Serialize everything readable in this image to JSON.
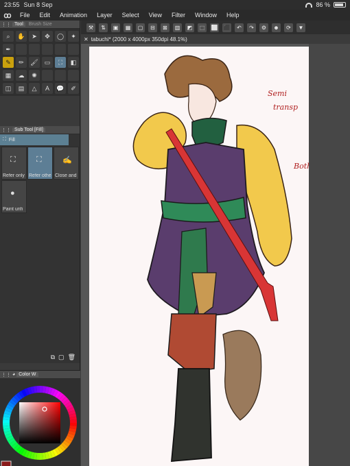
{
  "status": {
    "time": "23:55",
    "date": "Sun 8 Sep",
    "battery": "86 %"
  },
  "menu": [
    "File",
    "Edit",
    "Animation",
    "Layer",
    "Select",
    "View",
    "Filter",
    "Window",
    "Help"
  ],
  "tool_panel": {
    "tab_tool": "Tool",
    "tab_brush": "Brush Size"
  },
  "subtool_panel": {
    "title": "Sub Tool [Fill]",
    "group": "Fill",
    "items": [
      "Refer only",
      "Refer othe",
      "Close and",
      "Paint unfi"
    ]
  },
  "color_panel": {
    "title": "Color W",
    "h": "1",
    "s": "64",
    "v": "89"
  },
  "document": {
    "tab_title": "tabuchi* (2000 x 4000px 350dpi 48.1%)"
  },
  "canvas_notes": {
    "line1": "Semi",
    "line2": "transp",
    "line3": "Both"
  },
  "colors": {
    "accent_fill": "#5c8093",
    "active_tool": "#caa10d",
    "paper": "#fcf6f6"
  }
}
